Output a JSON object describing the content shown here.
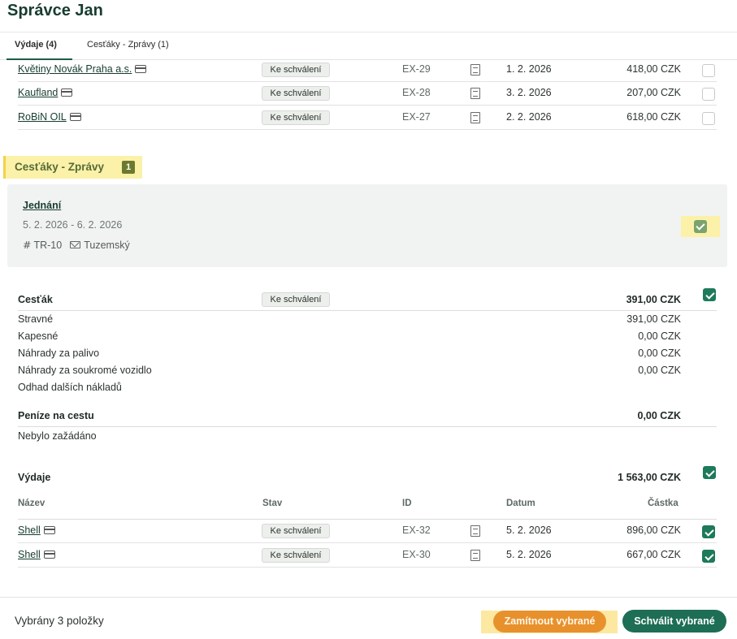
{
  "header": {
    "title": "Správce Jan"
  },
  "tabs": [
    {
      "label": "Výdaje (4)",
      "active": true
    },
    {
      "label": "Cesťáky - Zprávy (1)",
      "active": false
    }
  ],
  "expenses_top": [
    {
      "name": "Květiny Novák Praha a.s.",
      "status": "Ke schválení",
      "id": "EX-29",
      "date": "1. 2. 2026",
      "amount": "418,00 CZK",
      "checked": false
    },
    {
      "name": "Kaufland",
      "status": "Ke schválení",
      "id": "EX-28",
      "date": "3. 2. 2026",
      "amount": "207,00 CZK",
      "checked": false
    },
    {
      "name": "RoBiN OIL",
      "status": "Ke schválení",
      "id": "EX-27",
      "date": "2. 2. 2026",
      "amount": "618,00 CZK",
      "checked": false
    }
  ],
  "trips_section": {
    "title": "Cesťáky - Zprávy",
    "count": "1"
  },
  "trip": {
    "title": "Jednání",
    "dates": "5. 2. 2026 - 6. 2. 2026",
    "code": "TR-10",
    "type": "Tuzemský",
    "checked": true
  },
  "travel_order": {
    "title": "Cesťák",
    "status": "Ke schválení",
    "total": "391,00 CZK",
    "checked": true,
    "items": [
      {
        "label": "Stravné",
        "value": "391,00 CZK"
      },
      {
        "label": "Kapesné",
        "value": "0,00 CZK"
      },
      {
        "label": "Náhrady za palivo",
        "value": "0,00 CZK"
      },
      {
        "label": "Náhrady za soukromé vozidlo",
        "value": "0,00 CZK"
      },
      {
        "label": "Odhad dalších nákladů",
        "value": ""
      }
    ]
  },
  "advance": {
    "title": "Peníze na cestu",
    "total": "0,00 CZK",
    "note": "Nebylo zažádáno"
  },
  "trip_expenses": {
    "title": "Výdaje",
    "total": "1 563,00 CZK",
    "checked": true,
    "columns": {
      "name": "Název",
      "status": "Stav",
      "id": "ID",
      "date": "Datum",
      "amount": "Částka"
    },
    "rows": [
      {
        "name": "Shell",
        "status": "Ke schválení",
        "id": "EX-32",
        "date": "5. 2. 2026",
        "amount": "896,00 CZK",
        "checked": true
      },
      {
        "name": "Shell",
        "status": "Ke schválení",
        "id": "EX-30",
        "date": "5. 2. 2026",
        "amount": "667,00 CZK",
        "checked": true
      }
    ]
  },
  "footer": {
    "selected_text": "Vybrány 3 položky",
    "reject_label": "Zamítnout vybrané",
    "approve_label": "Schválit vybrané"
  },
  "colors": {
    "brand_dark": "#173d2f",
    "approve": "#1d6e54",
    "reject": "#e8912c",
    "highlight": "#fcf1a8",
    "checkbox_on": "#1d7a5a"
  },
  "icons": [
    "card-icon",
    "document-icon",
    "hash-icon",
    "mail-icon",
    "checkbox-icon"
  ]
}
